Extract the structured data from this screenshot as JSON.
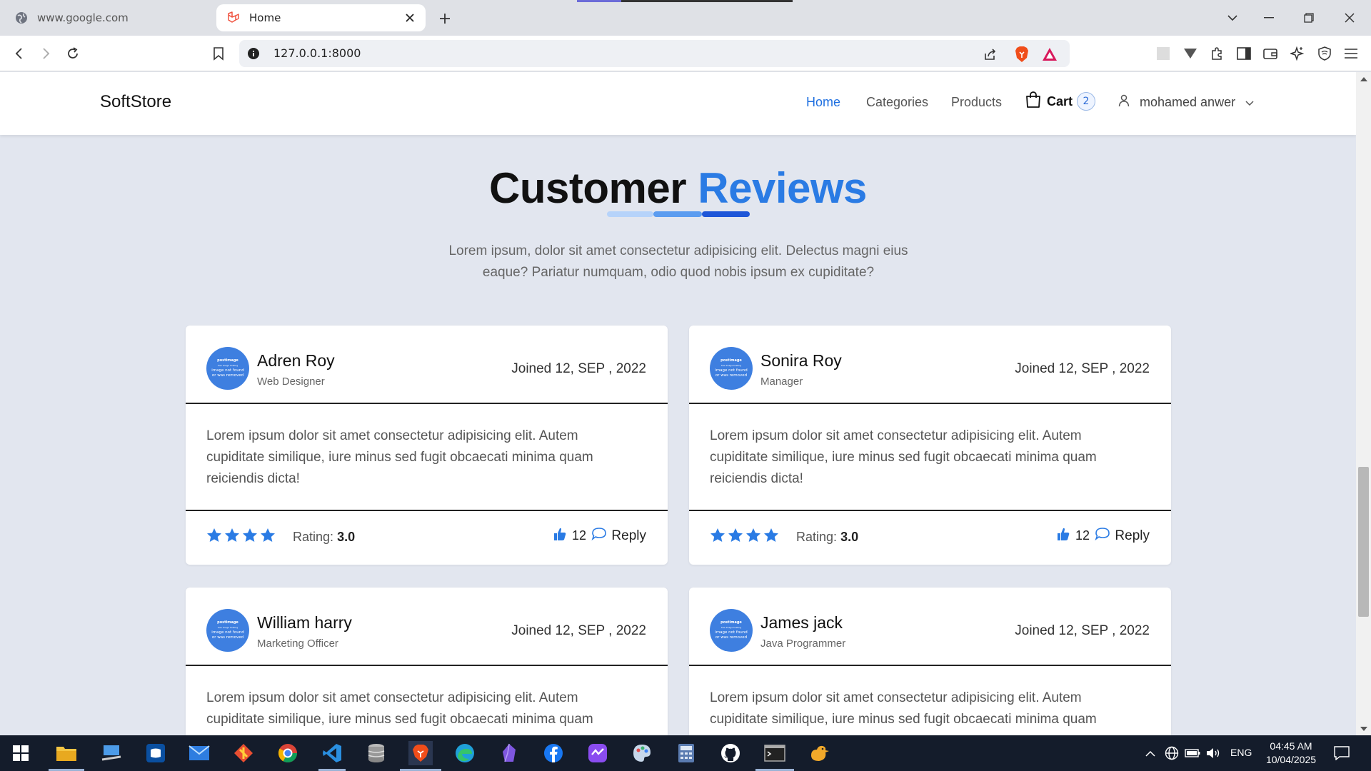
{
  "browser": {
    "tabs": [
      {
        "label": "www.google.com",
        "active": false
      },
      {
        "label": "Home",
        "active": true
      }
    ],
    "url": "127.0.0.1:8000"
  },
  "site": {
    "brand": "SoftStore",
    "nav": [
      {
        "label": "Home",
        "active": true
      },
      {
        "label": "Categories",
        "active": false
      },
      {
        "label": "Products",
        "active": false
      }
    ],
    "cart": {
      "label": "Cart",
      "count": "2"
    },
    "user": {
      "name": "mohamed anwer"
    }
  },
  "section": {
    "title_main": "Customer",
    "title_accent": "Reviews",
    "lead_line1": "Lorem ipsum, dolor sit amet consectetur adipisicing elit. Delectus magni eius",
    "lead_line2": "eaque? Pariatur numquam, odio quod nobis ipsum ex cupiditate?",
    "accent_color": "#2a7be4"
  },
  "reviews": [
    {
      "name": "Adren Roy",
      "role": "Web Designer",
      "joined": "Joined 12, SEP , 2022",
      "avatar_line1": "postimage",
      "avatar_line2": "free image hosting",
      "avatar_line3": "image not found",
      "avatar_line4": "or was removed",
      "text_line1": "Lorem ipsum dolor sit amet consectetur adipisicing elit. Autem",
      "text_line2": "cupiditate similique, iure minus sed fugit obcaecati minima quam",
      "text_line3": "reiciendis dicta!",
      "rating_label": "Rating:",
      "rating_value": "3.0",
      "stars": 4,
      "likes": "12",
      "reply_label": "Reply"
    },
    {
      "name": "Sonira Roy",
      "role": "Manager",
      "joined": "Joined 12, SEP , 2022",
      "avatar_line1": "postimage",
      "avatar_line2": "free image hosting",
      "avatar_line3": "image not found",
      "avatar_line4": "or was removed",
      "text_line1": "Lorem ipsum dolor sit amet consectetur adipisicing elit. Autem",
      "text_line2": "cupiditate similique, iure minus sed fugit obcaecati minima quam",
      "text_line3": "reiciendis dicta!",
      "rating_label": "Rating:",
      "rating_value": "3.0",
      "stars": 4,
      "likes": "12",
      "reply_label": "Reply"
    },
    {
      "name": "William harry",
      "role": "Marketing Officer",
      "joined": "Joined 12, SEP , 2022",
      "avatar_line1": "postimage",
      "avatar_line2": "free image hosting",
      "avatar_line3": "image not found",
      "avatar_line4": "or was removed",
      "text_line1": "Lorem ipsum dolor sit amet consectetur adipisicing elit. Autem",
      "text_line2": "cupiditate similique, iure minus sed fugit obcaecati minima quam"
    },
    {
      "name": "James jack",
      "role": "Java Programmer",
      "joined": "Joined 12, SEP , 2022",
      "avatar_line1": "postimage",
      "avatar_line2": "free image hosting",
      "avatar_line3": "image not found",
      "avatar_line4": "or was removed",
      "text_line1": "Lorem ipsum dolor sit amet consectetur adipisicing elit. Autem",
      "text_line2": "cupiditate similique, iure minus sed fugit obcaecati minima quam"
    }
  ],
  "taskbar": {
    "lang": "ENG",
    "time": "04:45 AM",
    "date": "10/04/2025"
  }
}
